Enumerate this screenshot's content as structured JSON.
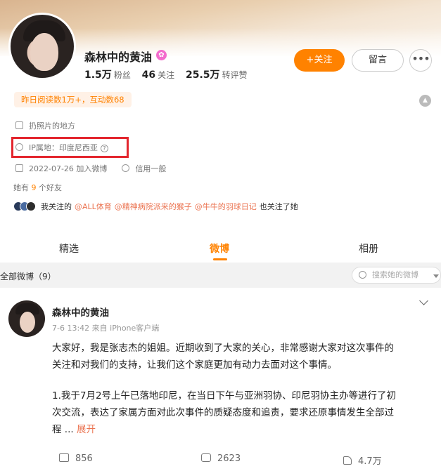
{
  "profile": {
    "name": "森林中的黄油",
    "stats": [
      {
        "value": "1.5万",
        "label": "粉丝"
      },
      {
        "value": "46",
        "label": "关注"
      },
      {
        "value": "25.5万",
        "label": "转评赞"
      }
    ],
    "follow_label": "+关注",
    "message_label": "留言",
    "more_label": "•••",
    "read_stats": "昨日阅读数1万+，互动数68",
    "description": "扔照片的地方",
    "ip_location": "IP属地：印度尼西亚",
    "joined": "2022-07-26 加入微博",
    "credit": "信用一般",
    "friends_prefix": "她有",
    "friends_count": "9",
    "friends_suffix": "个好友",
    "mutual_lead": "我关注的",
    "mutual_users": [
      "@ALL体育",
      "@精神病院派来的猴子",
      "@牛牛的羽球日记"
    ],
    "mutual_tail": "也关注了她"
  },
  "tabs": [
    "精选",
    "微博",
    "相册"
  ],
  "filter": {
    "label": "全部微博（9）",
    "search_placeholder": "搜索她的微博"
  },
  "post": {
    "author": "森林中的黄油",
    "meta": "7-6 13:42 来自 iPhone客户端",
    "text_lines": [
      "大家好，我是张志杰的姐姐。近期收到了大家的关心，非常感谢大家对这次事件的",
      "关注和对我们的支持，让我们这个家庭更加有动力去面对这个事情。",
      "1.我于7月2号上午已落地印尼，在当日下午与亚洲羽协、印尼羽协主办等进行了初",
      "次交流，表达了家属方面对此次事件的质疑态度和追责，要求还原事情发生全部过"
    ],
    "last_line_prefix": "程 ...",
    "expand_label": "展开",
    "reposts": "856",
    "comments": "2623",
    "likes": "4.7万"
  },
  "colors": {
    "accent": "#ff8200",
    "link": "#eb7350",
    "highlight_box": "#e3262e"
  }
}
